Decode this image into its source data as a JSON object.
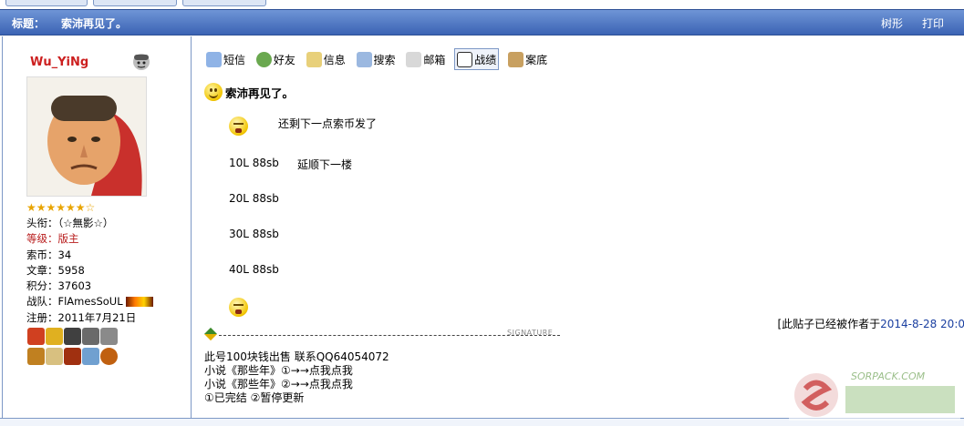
{
  "page": {
    "subject_label": "标题：",
    "subject": "索沛再见了。",
    "actions": [
      "树形",
      "打印"
    ]
  },
  "user": {
    "name": "Wu_YiNg",
    "stars": "★★★★★★☆",
    "lines": [
      {
        "text": "头衔：（☆無影☆）",
        "style": "normal"
      },
      {
        "text": "等级：版主",
        "style": "red"
      },
      {
        "text": "索币：34",
        "style": "normal"
      },
      {
        "text": "文章：5958",
        "style": "normal"
      },
      {
        "text": "积分：37603",
        "style": "normal"
      },
      {
        "text": "战队：FlAmesSoUL",
        "style": "normal"
      },
      {
        "text": "注册：2011年7月21日",
        "style": "normal"
      }
    ]
  },
  "toolbar": [
    {
      "label": "短信",
      "icon": "message-icon",
      "color": "#8fb3e6"
    },
    {
      "label": "好友",
      "icon": "friends-icon",
      "color": "#6aa84f"
    },
    {
      "label": "信息",
      "icon": "info-icon",
      "color": "#e8d07a"
    },
    {
      "label": "搜索",
      "icon": "search-icon",
      "color": "#9bb8e0"
    },
    {
      "label": "邮箱",
      "icon": "mail-icon",
      "color": "#d8d8d8"
    },
    {
      "label": "战绩",
      "icon": "record-icon",
      "color": "#2d2d2d"
    },
    {
      "label": "案底",
      "icon": "file-icon",
      "color": "#c8a060"
    }
  ],
  "post": {
    "title": "索沛再见了。",
    "first_line": "还剩下一点索币发了",
    "floors": [
      {
        "label": "10L 88sb",
        "note": "延顺下一楼"
      },
      {
        "label": "20L 88sb",
        "note": ""
      },
      {
        "label": "30L 88sb",
        "note": ""
      },
      {
        "label": "40L 88sb",
        "note": ""
      }
    ],
    "edit_prefix": "[此贴子已经被作者于",
    "edit_time": "2014-8-28 20:0"
  },
  "signature": {
    "divider_word": "SIGNATURE",
    "lines": [
      "此号100块钱出售  联系QQ64054072",
      "小说《那些年》①→→点我点我",
      "小说《那些年》②→→点我点我",
      "①已完结  ②暂停更新"
    ]
  },
  "watermark": {
    "text": "SORPACK.COM"
  }
}
